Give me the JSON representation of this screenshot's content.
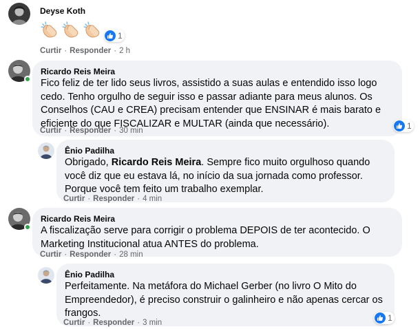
{
  "comments": [
    {
      "author": "Deyse Koth",
      "reaction_count": "1",
      "actions": {
        "like": "Curtir",
        "reply": "Responder",
        "time": "2 h"
      }
    },
    {
      "author": "Ricardo Reis Meira",
      "text": "Fico feliz de ter lido seus livros, assistido a suas aulas e entendido isso logo cedo. Tenho orgulho de seguir isso e passar adiante para meus alunos. Os Conselhos (CAU e CREA) precisam entender que ENSINAR é mais barato e eficiente do que FISCALIZAR e MULTAR (ainda que necessário).",
      "reaction_count": "1",
      "actions": {
        "like": "Curtir",
        "reply": "Responder",
        "time": "30 min"
      },
      "reply": {
        "author": "Ênio Padilha",
        "text_before": "Obrigado, ",
        "text_bold": "Ricardo Reis Meira",
        "text_after": ". Sempre fico muito orgulhoso quando você diz que eu estava lá, no início da sua jornada como professor. Porque você tem feito um trabalho exemplar.",
        "actions": {
          "like": "Curtir",
          "reply": "Responder",
          "time": "4 min"
        }
      }
    },
    {
      "author": "Ricardo Reis Meira",
      "text": "A fiscalização serve para corrigir o problema DEPOIS de ter acontecido. O Marketing Institucional atua ANTES do problema.",
      "actions": {
        "like": "Curtir",
        "reply": "Responder",
        "time": "28 min"
      },
      "reply": {
        "author": "Ênio Padilha",
        "text": "Perfeitamente. Na metáfora do Michael Gerber (no livro O Mito do Empreendedor), é preciso construir o galinheiro e não apenas cercar os frangos.",
        "reaction_count": "1",
        "actions": {
          "like": "Curtir",
          "reply": "Responder",
          "time": "3 min"
        }
      }
    }
  ],
  "separator": "·",
  "colors": {
    "like_blue": "#1877f2",
    "online_green": "#31a24c",
    "bubble_bg": "#f0f2f5",
    "meta_gray": "#65676b"
  },
  "icons": {
    "reaction": "thumbs-up-icon",
    "emoji": "clapping-hands-emoji"
  }
}
